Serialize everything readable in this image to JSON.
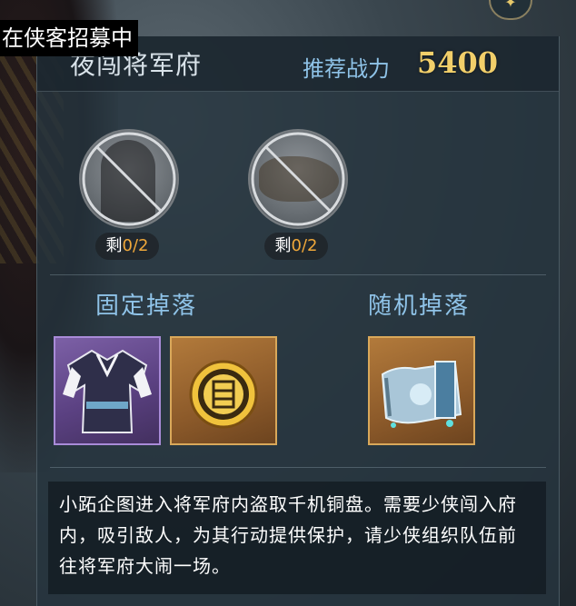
{
  "recruit_label": "在侠客招募中",
  "top_badge_icon": "double-chevron-icon",
  "stage": {
    "title": "夜闯将军府",
    "power_label": "推荐战力",
    "power_value": "5400"
  },
  "enemies": [
    {
      "icon": "masked-warrior-portrait",
      "remaining_prefix": "剩",
      "remaining_value": "0/2"
    },
    {
      "icon": "beast-portrait",
      "remaining_prefix": "剩",
      "remaining_value": "0/2"
    }
  ],
  "drops": {
    "fixed_title": "固定掉落",
    "random_title": "随机掉落",
    "fixed_items": [
      {
        "icon": "purple-robe-icon",
        "rarity_color": "#a98bd8"
      },
      {
        "icon": "gold-coin-icon",
        "rarity_color": "#d9a85a"
      }
    ],
    "random_items": [
      {
        "icon": "scroll-painting-icon",
        "rarity_color": "#d9a85a"
      }
    ]
  },
  "description": "小跖企图进入将军府内盗取千机铜盘。需要少侠闯入府内，吸引敌人，为其行动提供保护，请少侠组织队伍前往将军府大闹一场。",
  "colors": {
    "accent_blue": "#8fc3e8",
    "power_gold": "#f2cf6a",
    "count_orange": "#f0a83a"
  }
}
